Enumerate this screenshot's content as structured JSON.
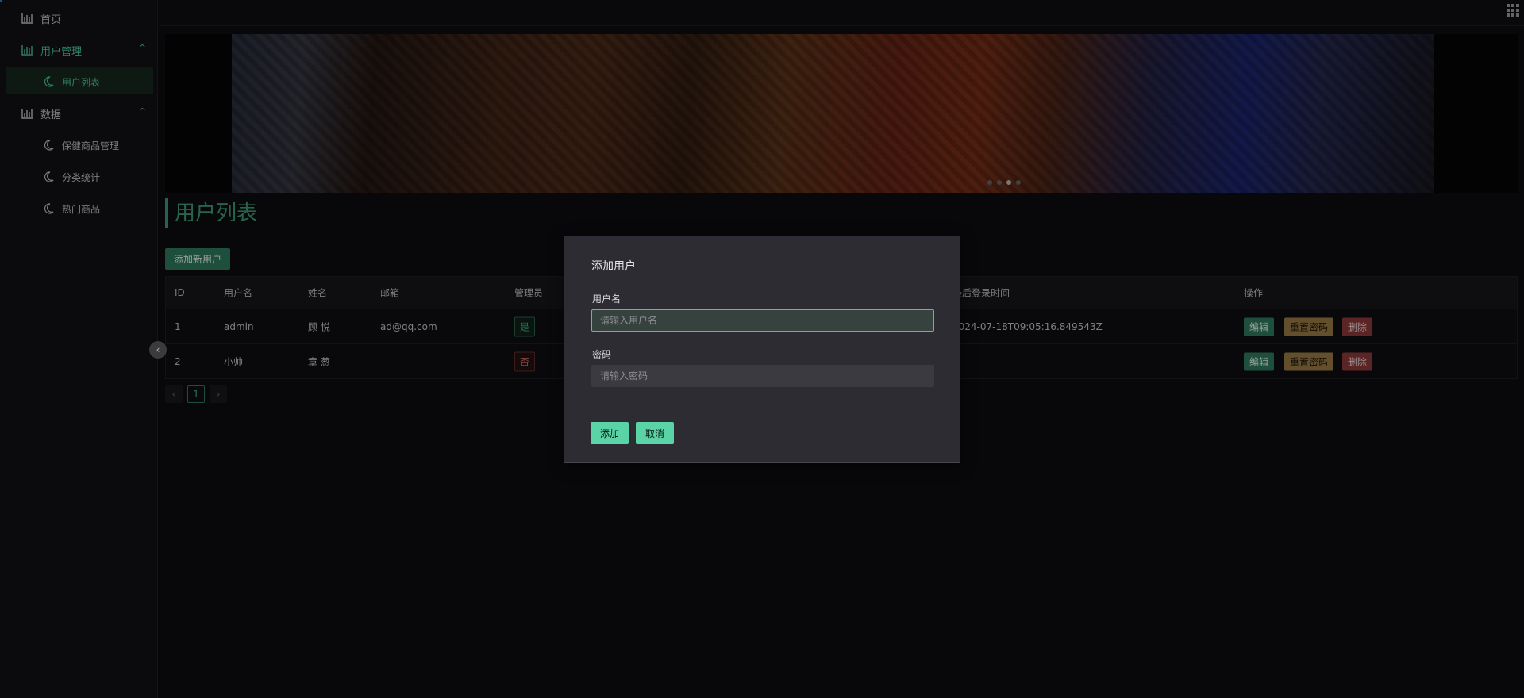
{
  "sidebar": {
    "items": [
      {
        "label": "首页"
      },
      {
        "label": "用户管理",
        "expanded": true,
        "children": [
          {
            "label": "用户列表",
            "active": true
          }
        ]
      },
      {
        "label": "数据",
        "expanded": true,
        "children": [
          {
            "label": "保健商品管理"
          },
          {
            "label": "分类统计"
          },
          {
            "label": "热门商品"
          }
        ]
      }
    ],
    "expand_arrow": "^",
    "collapse_glyph": "‹"
  },
  "banner": {
    "slide_count": 4,
    "active_slide": 2
  },
  "page": {
    "title": "用户列表",
    "add_button": "添加新用户"
  },
  "table": {
    "columns": [
      "ID",
      "用户名",
      "姓名",
      "邮箱",
      "管理员",
      "最后登录时间",
      "操作"
    ],
    "rows": [
      {
        "id": "1",
        "username": "admin",
        "name": "顾 悦",
        "email": "ad@qq.com",
        "admin": "是",
        "last_login": "2024-07-18T09:05:16.849543Z",
        "ops": [
          "编辑",
          "重置密码",
          "删除"
        ]
      },
      {
        "id": "2",
        "username": "小帅",
        "name": "章 葱",
        "email": "",
        "admin": "否",
        "last_login": "",
        "ops": [
          "编辑",
          "重置密码",
          "删除"
        ]
      }
    ]
  },
  "pager": {
    "prev": "‹",
    "current": "1",
    "next": "›"
  },
  "modal": {
    "title": "添加用户",
    "username_label": "用户名",
    "username_placeholder": "请输入用户名",
    "password_label": "密码",
    "password_placeholder": "请输入密码",
    "confirm": "添加",
    "cancel": "取消"
  },
  "colors": {
    "accent": "#3d9a76",
    "accent_bright": "#5ad3a7",
    "danger": "#8d3a3a",
    "warning": "#9a7a45"
  }
}
